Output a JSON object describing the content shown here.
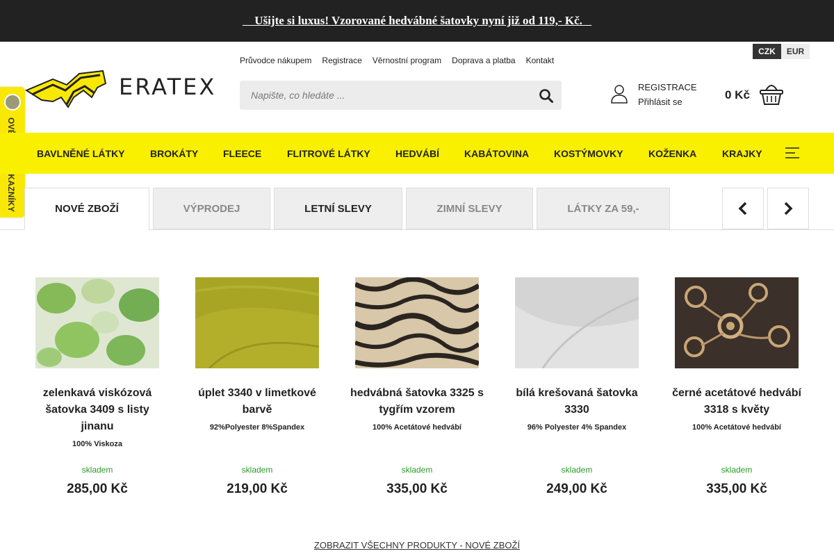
{
  "topbar": {
    "text": " Ušijte si luxus! Vzorované hedvábné šatovky nyní již od 119,- Kč."
  },
  "trust_badge": {
    "text": "OVĚŘENO ZÁKAZNÍKY"
  },
  "logo": {
    "text": "ERATEX"
  },
  "toplinks": [
    "Průvodce nákupem",
    "Registrace",
    "Věrnostní program",
    "Doprava a platba",
    "Kontakt"
  ],
  "currency": {
    "czk": "CZK",
    "eur": "EUR"
  },
  "search": {
    "placeholder": "Napište, co hledáte ..."
  },
  "account": {
    "register": "REGISTRACE",
    "login": "Přihlásit se"
  },
  "cart": {
    "price": "0 Kč"
  },
  "nav": [
    "BAVLNĚNÉ LÁTKY",
    "BROKÁTY",
    "FLEECE",
    "FLITROVÉ LÁTKY",
    "HEDVÁBÍ",
    "KABÁTOVINA",
    "KOSTÝMOVKY",
    "KOŽENKA",
    "KRAJKY"
  ],
  "tabs": [
    "NOVÉ ZBOŽÍ",
    "VÝPRODEJ",
    "LETNÍ SLEVY",
    "ZIMNÍ SLEVY",
    "LÁTKY ZA 59,-"
  ],
  "products": [
    {
      "title": "zelenkavá viskózová šatovka 3409 s listy jinanu",
      "composition": "100% Viskoza",
      "stock": "skladem",
      "price": "285,00 Kč"
    },
    {
      "title": "úplet 3340 v limetkové barvě",
      "composition": "92%Polyester 8%Spandex",
      "stock": "skladem",
      "price": "219,00 Kč"
    },
    {
      "title": "hedvábná šatovka 3325 s tygřím vzorem",
      "composition": "100% Acetátové hedvábí",
      "stock": "skladem",
      "price": "335,00 Kč"
    },
    {
      "title": "bílá krešovaná šatovka 3330",
      "composition": "96% Polyester 4% Spandex",
      "stock": "skladem",
      "price": "249,00 Kč"
    },
    {
      "title": "černé acetátové hedvábí 3318 s květy",
      "composition": "100% Acetátové hedvábí",
      "stock": "skladem",
      "price": "335,00 Kč"
    }
  ],
  "show_all": "ZOBRAZIT VŠECHNY PRODUKTY - NOVÉ ZBOŽÍ",
  "colors": {
    "accent_yellow": "#f9f000",
    "topbar_bg": "#222222",
    "stock_green": "#2a9a2a"
  }
}
